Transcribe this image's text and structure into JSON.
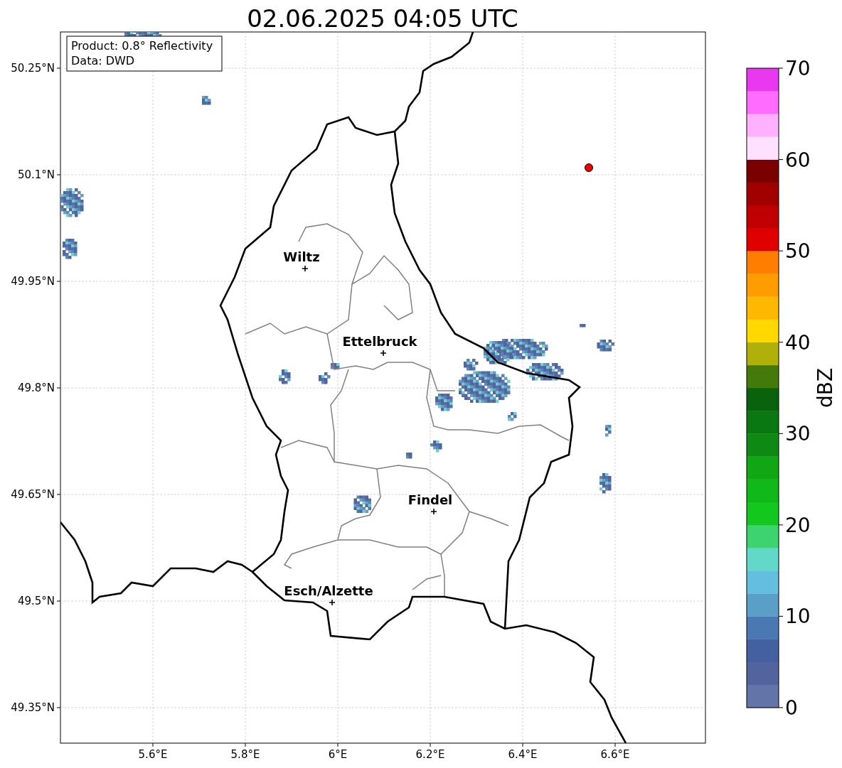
{
  "title": "02.06.2025 04:05 UTC",
  "info_box": {
    "lines": [
      "Product: 0.8° Reflectivity",
      "Data: DWD"
    ]
  },
  "map": {
    "x_ticks": [
      "5.6°E",
      "5.8°E",
      "6°E",
      "6.2°E",
      "6.4°E",
      "6.6°E"
    ],
    "y_ticks": [
      "50.25°N",
      "50.1°N",
      "49.95°N",
      "49.8°N",
      "49.65°N",
      "49.5°N",
      "49.35°N"
    ],
    "places": [
      {
        "name": "Wiltz"
      },
      {
        "name": "Ettelbruck"
      },
      {
        "name": "Findel"
      },
      {
        "name": "Esch/Alzette"
      }
    ]
  },
  "colorbar": {
    "label": "dBZ",
    "ticks": [
      "70",
      "60",
      "50",
      "40",
      "30",
      "20",
      "10",
      "0"
    ],
    "bins": [
      {
        "color": "#6274a8"
      },
      {
        "color": "#52649d"
      },
      {
        "color": "#4560a0"
      },
      {
        "color": "#4a78b0"
      },
      {
        "color": "#5a9fc8"
      },
      {
        "color": "#64bedd"
      },
      {
        "color": "#62d8c8"
      },
      {
        "color": "#3cd46e"
      },
      {
        "color": "#12c81e"
      },
      {
        "color": "#10b81a"
      },
      {
        "color": "#10a614"
      },
      {
        "color": "#0e8a14"
      },
      {
        "color": "#0a7810"
      },
      {
        "color": "#08620e"
      },
      {
        "color": "#437a0a"
      },
      {
        "color": "#b0b00a"
      },
      {
        "color": "#ffd800"
      },
      {
        "color": "#ffb800"
      },
      {
        "color": "#ff9c00"
      },
      {
        "color": "#ff7e00"
      },
      {
        "color": "#e00000"
      },
      {
        "color": "#c00000"
      },
      {
        "color": "#a00000"
      },
      {
        "color": "#7a0000"
      },
      {
        "color": "#ffe0ff"
      },
      {
        "color": "#ffb0ff"
      },
      {
        "color": "#ff6cff"
      },
      {
        "color": "#e838f0"
      }
    ]
  }
}
